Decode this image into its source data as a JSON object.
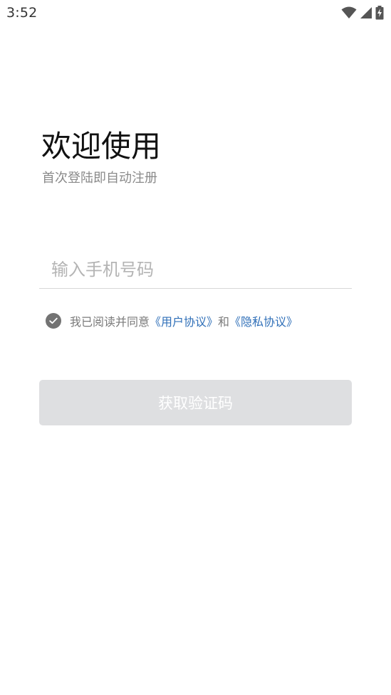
{
  "status_bar": {
    "time": "3:52",
    "icons": [
      "wifi-icon",
      "signal-icon",
      "battery-charging-icon"
    ]
  },
  "login": {
    "title": "欢迎使用",
    "subtitle": "首次登陆即自动注册",
    "phone_placeholder": "输入手机号码",
    "phone_value": "",
    "agreement": {
      "checked": true,
      "prefix": "我已阅读并同意",
      "user_agreement": "《用户协议》",
      "and": "和",
      "privacy_policy": "《隐私协议》"
    },
    "get_code_label": "获取验证码"
  },
  "colors": {
    "link": "#2f6fb8",
    "button_disabled_bg": "#dedfe1",
    "button_text": "#ffffff",
    "checkbox_fill": "#737373"
  }
}
